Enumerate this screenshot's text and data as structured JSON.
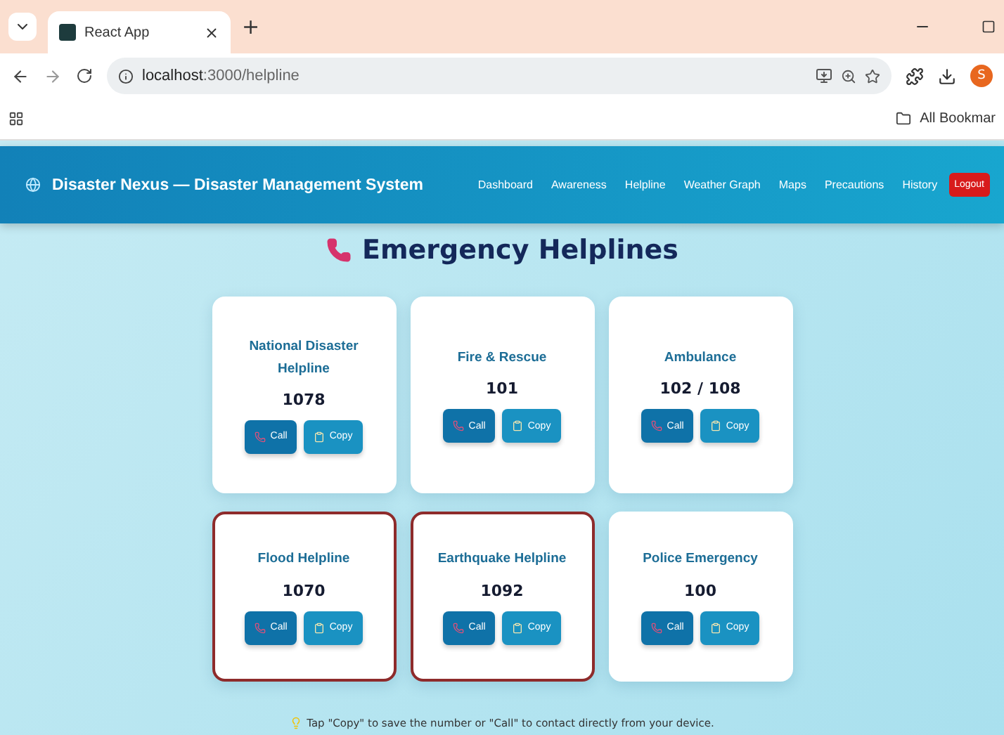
{
  "browser": {
    "tab_title": "React App",
    "new_tab": "+",
    "url_host": "localhost",
    "url_path": ":3000/helpline",
    "profile_initial": "S",
    "bookmarks_label": "All Bookmar"
  },
  "navbar": {
    "brand": "Disaster Nexus — Disaster Management System",
    "links": [
      "Dashboard",
      "Awareness",
      "Helpline",
      "Weather Graph",
      "Maps",
      "Precautions",
      "History"
    ],
    "logout": "Logout"
  },
  "page_title": "Emergency Helplines",
  "helplines": [
    {
      "name": "National Disaster Helpline",
      "number": "1078",
      "alert": false,
      "call_label": "Call",
      "copy_label": "Copy"
    },
    {
      "name": "Fire & Rescue",
      "number": "101",
      "alert": false,
      "call_label": "Call",
      "copy_label": "Copy"
    },
    {
      "name": "Ambulance",
      "number": "102 / 108",
      "alert": false,
      "call_label": "Call",
      "copy_label": "Copy"
    },
    {
      "name": "Flood Helpline",
      "number": "1070",
      "alert": true,
      "call_label": "Call",
      "copy_label": "Copy"
    },
    {
      "name": "Earthquake Helpline",
      "number": "1092",
      "alert": true,
      "call_label": "Call",
      "copy_label": "Copy"
    },
    {
      "name": "Police Emergency",
      "number": "100",
      "alert": false,
      "call_label": "Call",
      "copy_label": "Copy"
    }
  ],
  "footer_tip": "Tap \"Copy\" to save the number or \"Call\" to contact directly from your device."
}
